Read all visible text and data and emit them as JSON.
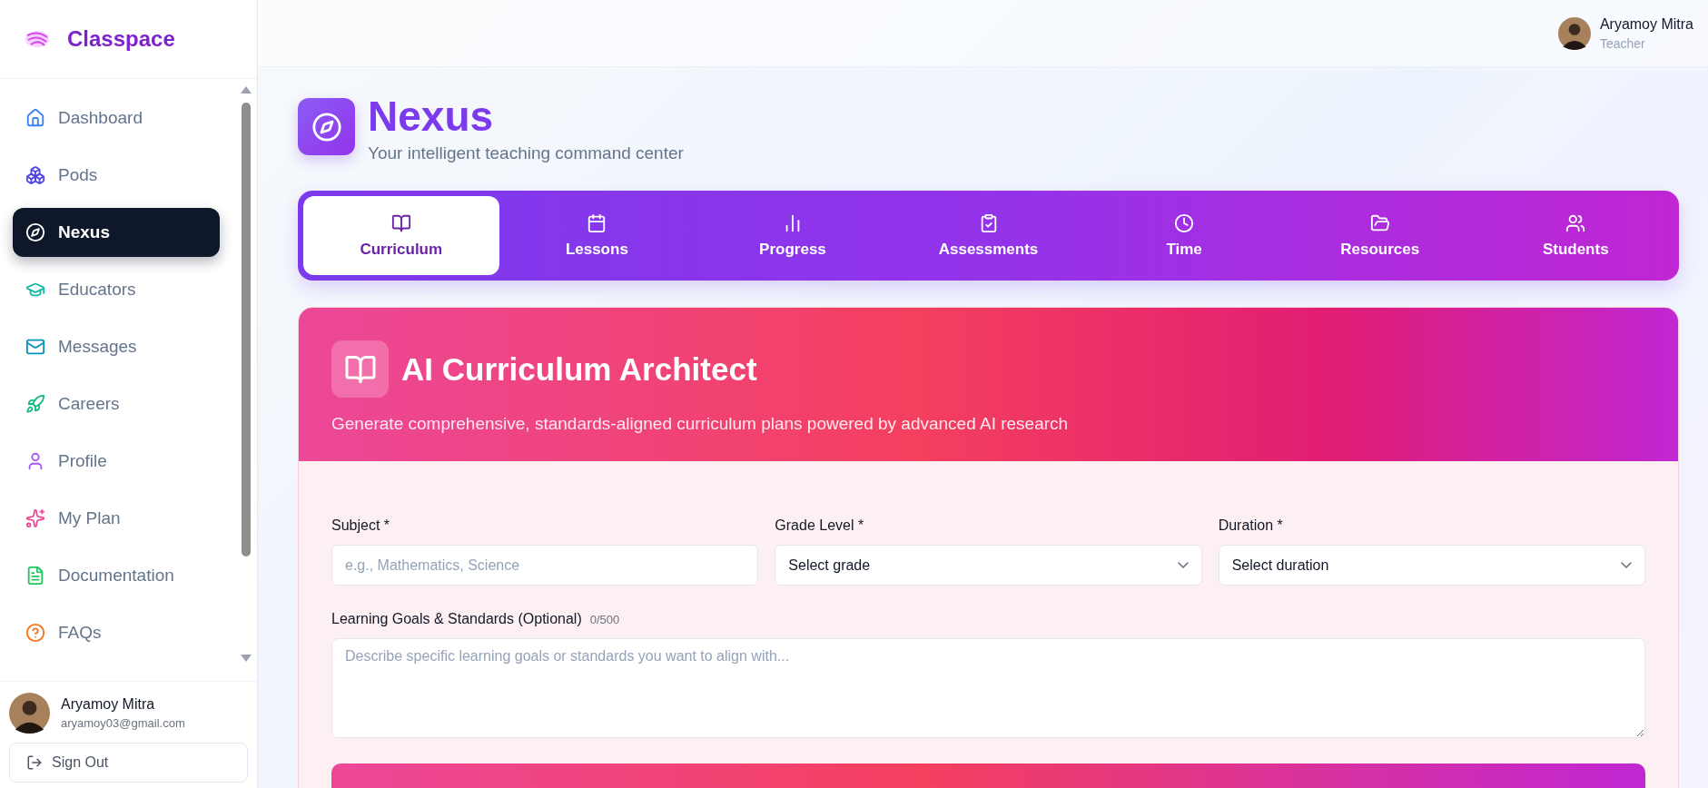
{
  "app": {
    "name": "Classpace"
  },
  "sidebar": {
    "items": [
      {
        "label": "Dashboard",
        "selected": false
      },
      {
        "label": "Pods",
        "selected": false
      },
      {
        "label": "Nexus",
        "selected": true
      },
      {
        "label": "Educators",
        "selected": false
      },
      {
        "label": "Messages",
        "selected": false
      },
      {
        "label": "Careers",
        "selected": false
      },
      {
        "label": "Profile",
        "selected": false
      },
      {
        "label": "My Plan",
        "selected": false
      },
      {
        "label": "Documentation",
        "selected": false
      },
      {
        "label": "FAQs",
        "selected": false
      }
    ]
  },
  "account": {
    "name": "Aryamoy Mitra",
    "email": "aryamoy03@gmail.com",
    "sign_out": "Sign Out"
  },
  "header": {
    "user_name": "Aryamoy Mitra",
    "role": "Teacher"
  },
  "page": {
    "title": "Nexus",
    "subtitle": "Your intelligent teaching command center"
  },
  "tabs": [
    {
      "label": "Curriculum",
      "selected": true
    },
    {
      "label": "Lessons",
      "selected": false
    },
    {
      "label": "Progress",
      "selected": false
    },
    {
      "label": "Assessments",
      "selected": false
    },
    {
      "label": "Time",
      "selected": false
    },
    {
      "label": "Resources",
      "selected": false
    },
    {
      "label": "Students",
      "selected": false
    }
  ],
  "card": {
    "title": "AI Curriculum Architect",
    "description": "Generate comprehensive, standards-aligned curriculum plans powered by advanced AI research"
  },
  "form": {
    "subject": {
      "label": "Subject *",
      "placeholder": "e.g., Mathematics, Science"
    },
    "grade": {
      "label": "Grade Level *",
      "value": "Select grade"
    },
    "duration": {
      "label": "Duration *",
      "value": "Select duration"
    },
    "goals": {
      "label": "Learning Goals & Standards (Optional)",
      "counter": "0/500",
      "placeholder": "Describe specific learning goals or standards you want to align with..."
    }
  }
}
